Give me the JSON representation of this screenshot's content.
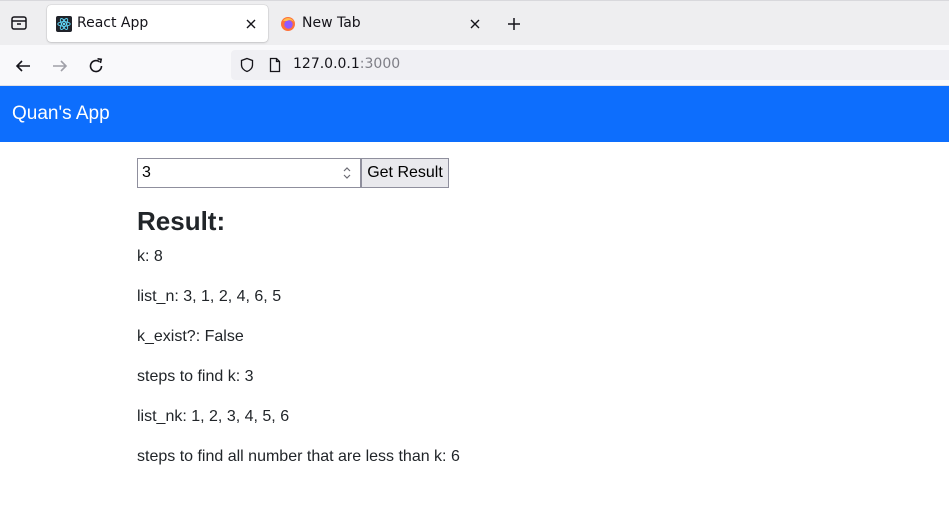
{
  "browser": {
    "tabs": [
      {
        "title": "React App",
        "favicon": "react-icon",
        "active": true
      },
      {
        "title": "New Tab",
        "favicon": "firefox-icon",
        "active": false
      }
    ],
    "address": {
      "host": "127.0.0.1",
      "port": ":3000"
    }
  },
  "app": {
    "title": "Quan's App",
    "input": {
      "value": "3"
    },
    "button_label": "Get Result",
    "result_heading": "Result:",
    "results": [
      "k: 8",
      "list_n: 3, 1, 2, 4, 6, 5",
      "k_exist?: False",
      "steps to find k: 3",
      "list_nk: 1, 2, 3, 4, 5, 6",
      "steps to find all number that are less than k: 6"
    ]
  },
  "colors": {
    "header_bg": "#0d6efd"
  }
}
